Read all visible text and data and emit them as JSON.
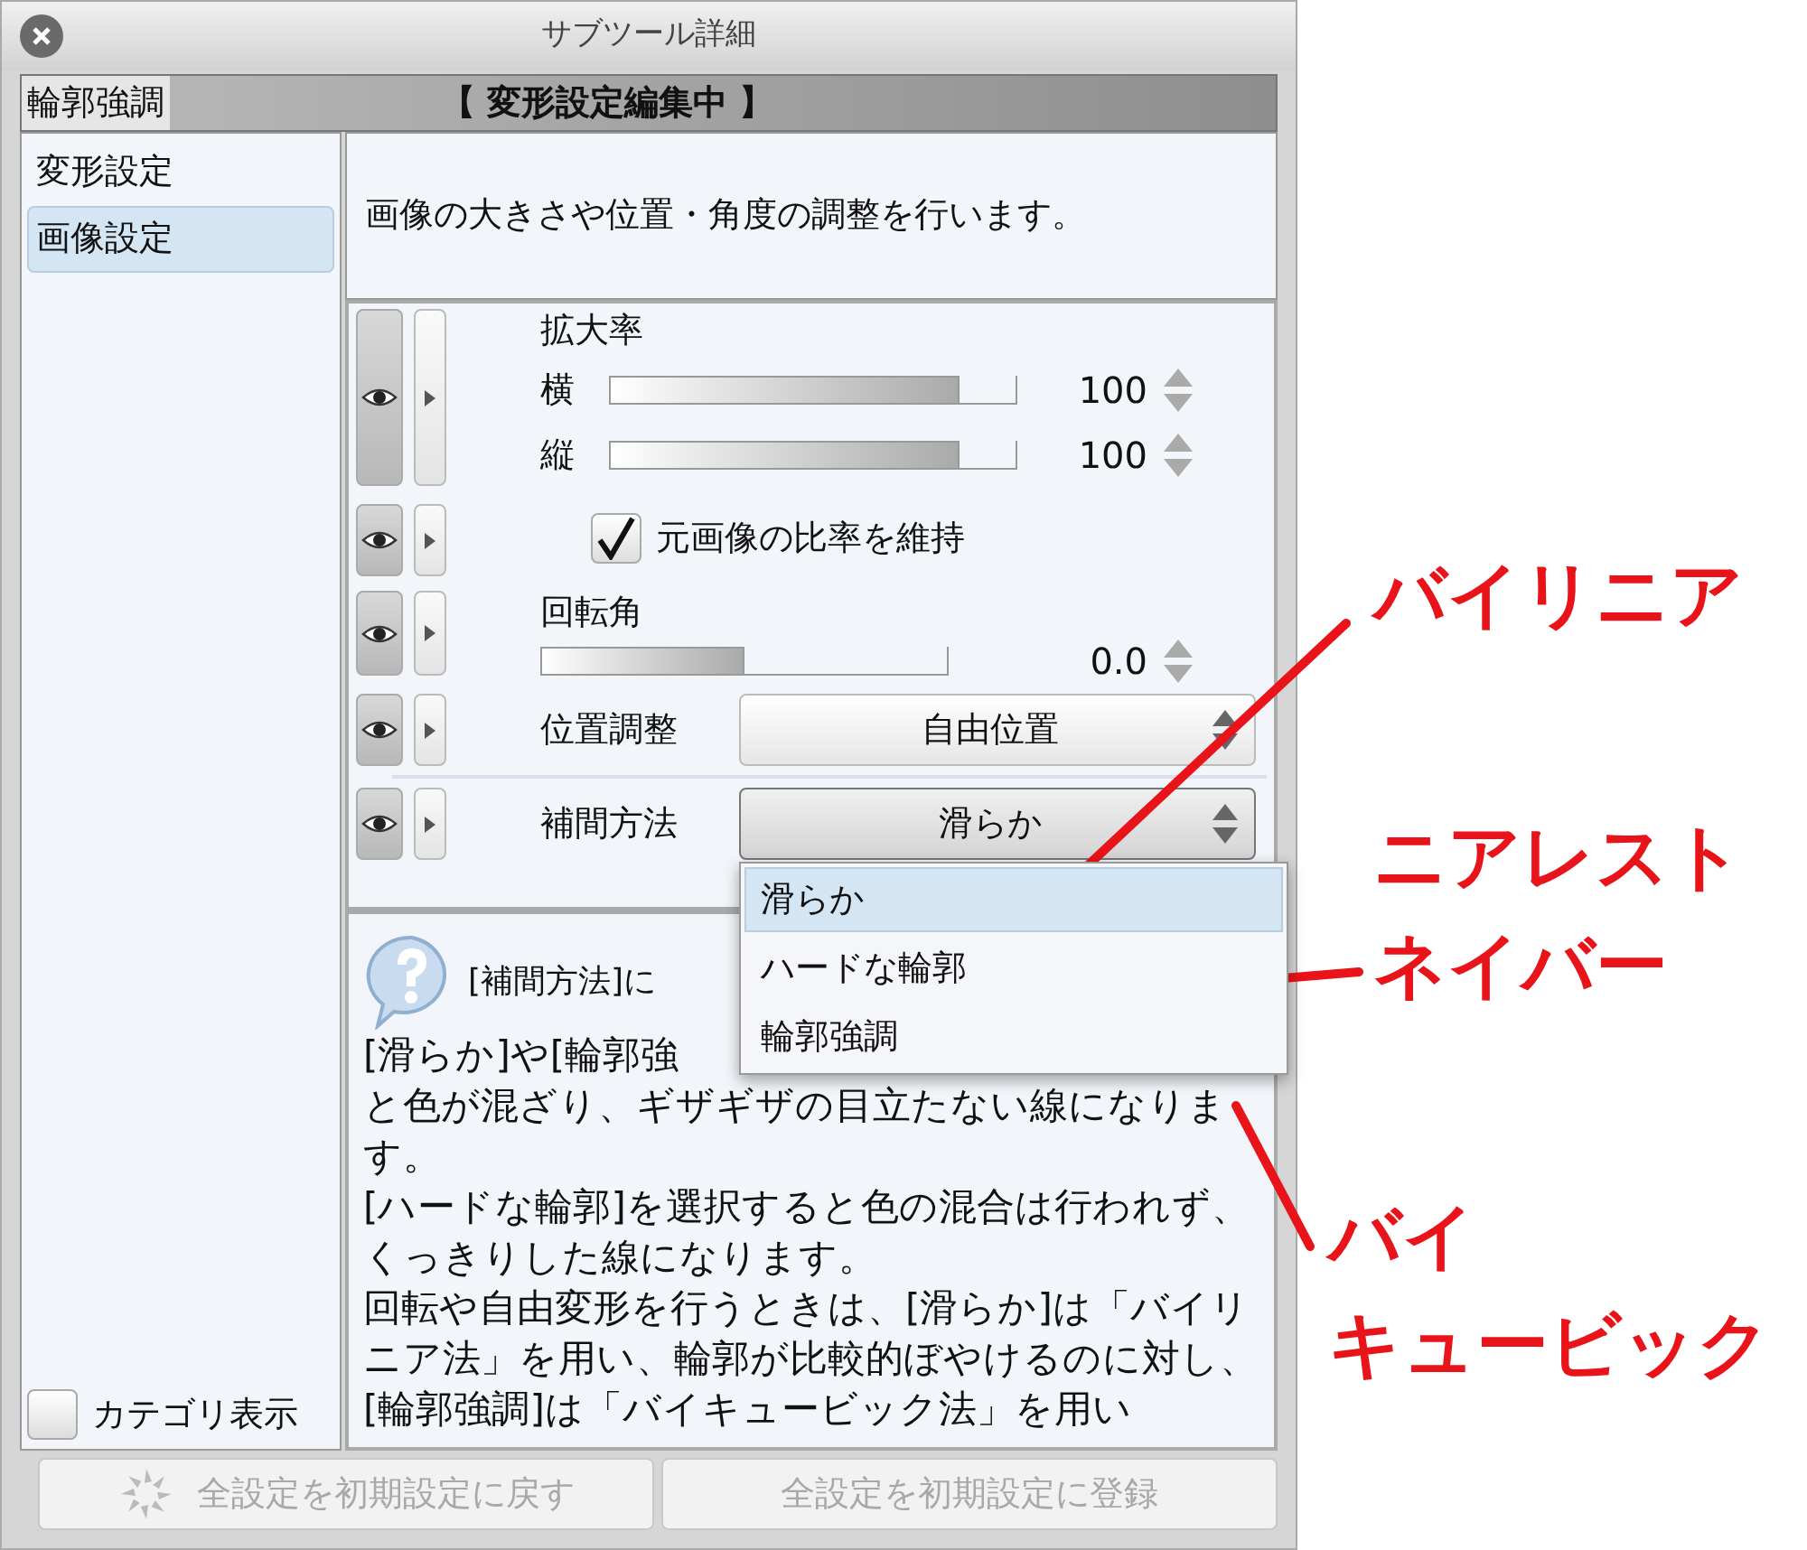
{
  "window": {
    "title": "サブツール詳細"
  },
  "header": {
    "tool_name": "輪郭強調",
    "status": "【 変形設定編集中 】"
  },
  "sidebar": {
    "items": [
      {
        "label": "変形設定",
        "selected": false
      },
      {
        "label": "画像設定",
        "selected": true
      }
    ],
    "category_toggle": {
      "label": "カテゴリ表示",
      "checked": false
    }
  },
  "description": "画像の大きさや位置・角度の調整を行います。",
  "settings": [
    {
      "kind": "sliders",
      "label": "拡大率",
      "sliders": [
        {
          "label": "横",
          "level": 0.86,
          "value": "100"
        },
        {
          "label": "縦",
          "level": 0.86,
          "value": "100"
        }
      ]
    },
    {
      "kind": "checkbox",
      "label": "元画像の比率を維持",
      "checked": true
    },
    {
      "kind": "slider",
      "label": "回転角",
      "level": 0.5,
      "value": "0.0"
    },
    {
      "kind": "select",
      "label": "位置調整",
      "value": "自由位置",
      "expanded": false
    },
    {
      "kind": "select",
      "label": "補間方法",
      "value": "滑らか",
      "expanded": true,
      "options": [
        {
          "label": "滑らか",
          "selected": true
        },
        {
          "label": "ハードな輪郭",
          "selected": false
        },
        {
          "label": "輪郭強調",
          "selected": false
        }
      ]
    }
  ],
  "help": {
    "title": "[補間方法]に",
    "lines": [
      "[滑らか]や[輪郭強",
      "と色が混ざり、ギザギザの目立たない線になります。",
      "[ハードな輪郭]を選択すると色の混合は行われず、くっきりした線になります。",
      "回転や自由変形を行うときは、[滑らか]は「バイリニア法」を用い、輪郭が比較的ぼやけるのに対し、[輪郭強調]は「バイキュービック法」を用い"
    ]
  },
  "buttons": [
    {
      "label": "全設定を初期設定に戻す",
      "disabled": true,
      "kind": "reset"
    },
    {
      "label": "全設定を初期設定に登録",
      "disabled": true,
      "kind": "register"
    }
  ],
  "annotations": [
    {
      "lines": [
        "バイリニア"
      ]
    },
    {
      "lines": [
        "ニアレスト",
        "ネイバー"
      ]
    },
    {
      "lines": [
        "バイ",
        "キュービック"
      ]
    }
  ]
}
